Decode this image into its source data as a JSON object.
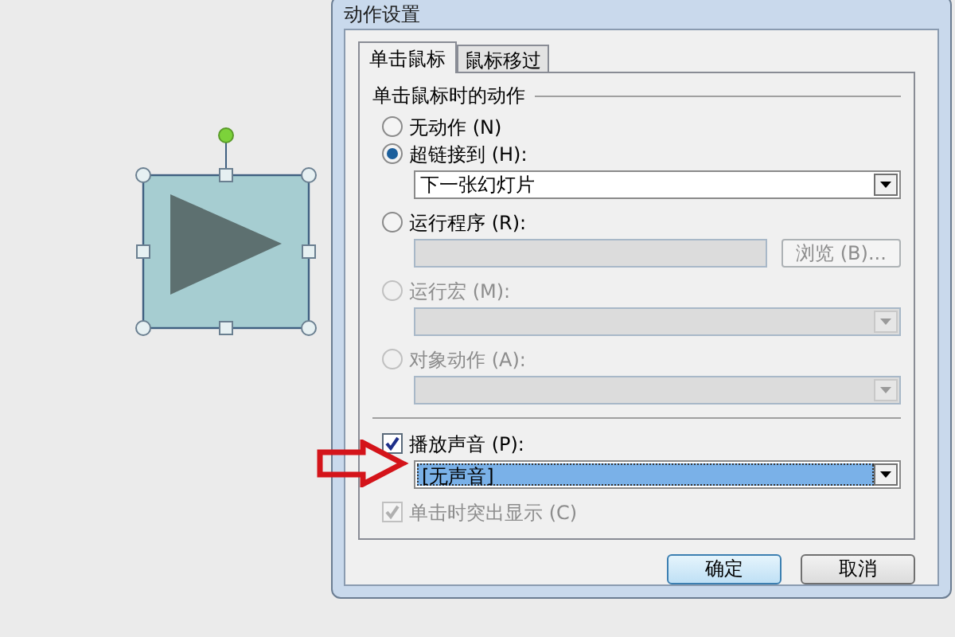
{
  "slide": {
    "shape": {
      "kind": "picture",
      "selected": true
    }
  },
  "window": {
    "title": "动作设置"
  },
  "tabs": [
    {
      "label": "单击鼠标",
      "selected": true
    },
    {
      "label": "鼠标移过",
      "selected": false
    }
  ],
  "group": {
    "title": "单击鼠标时的动作"
  },
  "actions": [
    {
      "label": "无动作 (N)",
      "selected": false,
      "disabled": false
    },
    {
      "label": "超链接到 (H):",
      "selected": true,
      "disabled": false,
      "field": {
        "kind": "dropdown",
        "value": "下一张幻灯片",
        "disabled": false
      }
    },
    {
      "label": "运行程序 (R):",
      "selected": false,
      "disabled": false,
      "field": {
        "kind": "text",
        "disabled": true,
        "button": "浏览 (B)..."
      }
    },
    {
      "label": "运行宏 (M):",
      "selected": false,
      "disabled": true,
      "field": {
        "kind": "dropdown",
        "disabled": true
      }
    },
    {
      "label": "对象动作 (A):",
      "selected": false,
      "disabled": true,
      "field": {
        "kind": "dropdown",
        "disabled": true
      }
    }
  ],
  "sound": {
    "label": "播放声音 (P):",
    "checked": true,
    "value": "[无声音]",
    "focused": true
  },
  "highlight": {
    "label": "单击时突出显示 (C)",
    "checked": true,
    "disabled": true
  },
  "annotation": {
    "kind": "arrow"
  },
  "buttons": [
    {
      "label": "确定",
      "default": true
    },
    {
      "label": "取消",
      "default": false
    }
  ]
}
